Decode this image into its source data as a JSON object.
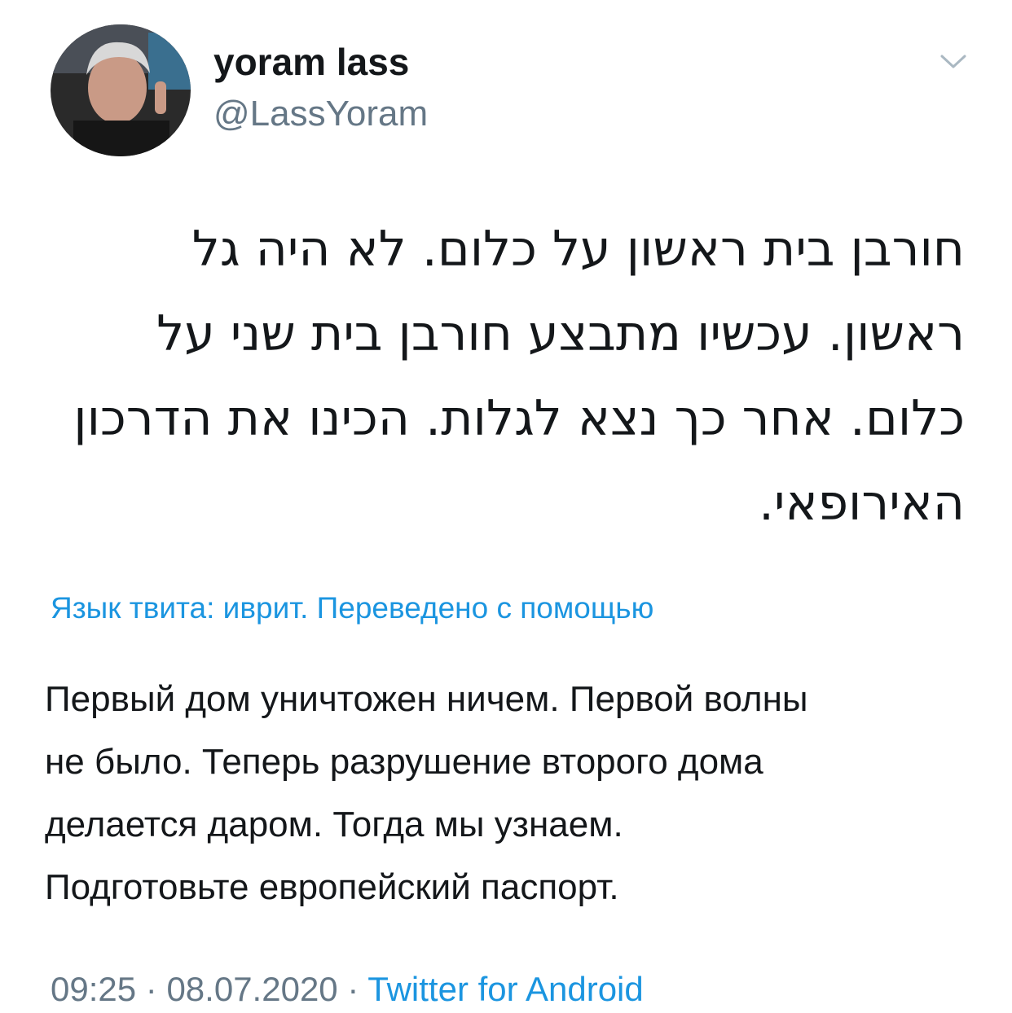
{
  "user": {
    "display_name": "yoram lass",
    "handle": "@LassYoram",
    "avatar_icon": "user-avatar-photo"
  },
  "menu": {
    "icon": "chevron-down-icon"
  },
  "tweet": {
    "text_lines": [
      "חורבן בית ראשון על כלום. לא היה גל",
      "ראשון. עכשיו מתבצע חורבן בית שני על",
      "כלום. אחר כך נצא לגלות. הכינו את הדרכון",
      "האירופאי."
    ],
    "translation_note": "Язык твита: иврит. Переведено с помощью",
    "translation_lines": [
      "Первый дом уничтожен ничем. Первой волны",
      "не было. Теперь разрушение второго дома",
      "делается даром. Тогда мы узнаем.",
      "Подготовьте европейский паспорт."
    ]
  },
  "meta": {
    "time": "09:25",
    "separator": "·",
    "date": "08.07.2020",
    "source": "Twitter for Android"
  },
  "colors": {
    "text": "#14171a",
    "secondary": "#657786",
    "link": "#1b95e0"
  }
}
